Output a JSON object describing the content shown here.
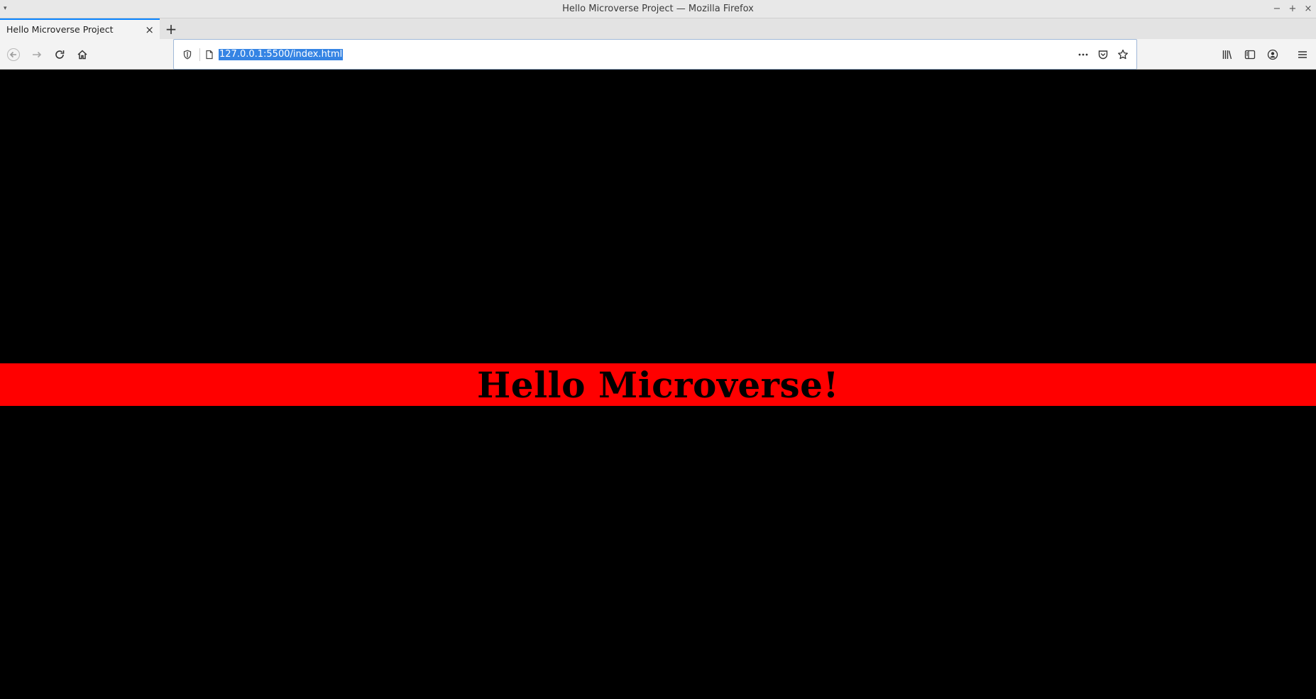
{
  "window": {
    "title": "Hello Microverse Project — Mozilla Firefox"
  },
  "tabs": [
    {
      "label": "Hello Microverse Project",
      "active": true
    }
  ],
  "urlbar": {
    "url": "127.0.0.1:5500/index.html",
    "selected": true
  },
  "page": {
    "heading": "Hello Microverse!",
    "background_color": "#000000",
    "banner_color": "#ff0000",
    "heading_color": "#000000"
  },
  "icons": {
    "back": "back-arrow-icon",
    "forward": "forward-arrow-icon",
    "reload": "reload-icon",
    "home": "home-icon",
    "tracking": "shield-icon",
    "page": "page-icon",
    "more": "more-actions-icon",
    "pocket": "pocket-icon",
    "bookmark": "star-icon",
    "library": "library-icon",
    "sidebar": "sidebar-icon",
    "account": "account-icon",
    "menu": "hamburger-menu-icon"
  }
}
